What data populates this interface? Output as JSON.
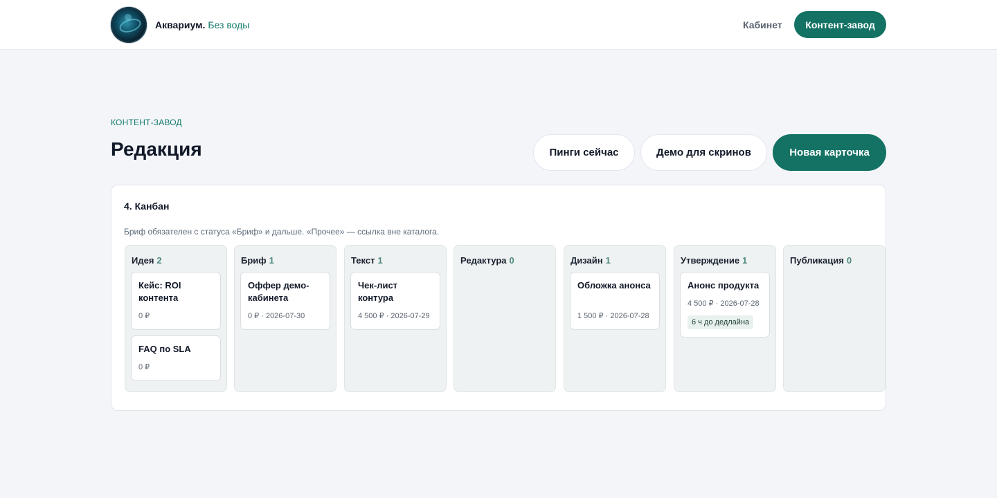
{
  "header": {
    "brand_name": "Аквариум.",
    "brand_tagline": "Без воды",
    "nav_link": "Кабинет",
    "nav_button": "Контент-завод"
  },
  "page": {
    "eyebrow": "КОНТЕНТ-ЗАВОД",
    "title": "Редакция",
    "actions": {
      "pings": "Пинги сейчас",
      "demo": "Демо для скринов",
      "new_card": "Новая карточка"
    }
  },
  "kanban": {
    "title": "4. Канбан",
    "description": "Бриф обязателен с статуса «Бриф» и дальше. «Прочее» — ссылка вне каталога.",
    "columns": [
      {
        "name": "Идея",
        "count": "2",
        "cards": [
          {
            "title": "Кейс: ROI контента",
            "meta": "0 ₽"
          },
          {
            "title": "FAQ по SLA",
            "meta": "0 ₽"
          }
        ]
      },
      {
        "name": "Бриф",
        "count": "1",
        "cards": [
          {
            "title": "Оффер демо-кабинета",
            "meta": "0 ₽ · 2026-07-30"
          }
        ]
      },
      {
        "name": "Текст",
        "count": "1",
        "cards": [
          {
            "title": "Чек-лист контура",
            "meta": "4 500 ₽ · 2026-07-29"
          }
        ]
      },
      {
        "name": "Редактура",
        "count": "0",
        "cards": []
      },
      {
        "name": "Дизайн",
        "count": "1",
        "cards": [
          {
            "title": "Обложка анонса",
            "meta": "1 500 ₽ · 2026-07-28"
          }
        ]
      },
      {
        "name": "Утверждение",
        "count": "1",
        "cards": [
          {
            "title": "Анонс продукта",
            "meta": "4 500 ₽ · 2026-07-28",
            "badge": "6 ч до дедлайна"
          }
        ]
      },
      {
        "name": "Публикация",
        "count": "0",
        "cards": []
      }
    ]
  }
}
